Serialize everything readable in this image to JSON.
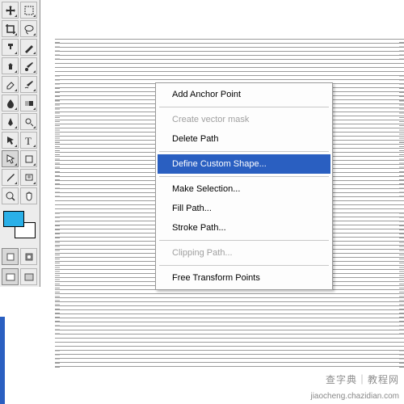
{
  "toolbox": {
    "swatch_fg": "#2ab0e8",
    "swatch_bg": "#ffffff"
  },
  "context_menu": {
    "items": [
      {
        "label": "Add Anchor Point",
        "disabled": false
      },
      {
        "sep": true
      },
      {
        "label": "Create vector mask",
        "disabled": true
      },
      {
        "label": "Delete Path",
        "disabled": false
      },
      {
        "sep": true
      },
      {
        "label": "Define Custom Shape...",
        "disabled": false,
        "highlight": true
      },
      {
        "sep": true
      },
      {
        "label": "Make Selection...",
        "disabled": false
      },
      {
        "label": "Fill Path...",
        "disabled": false
      },
      {
        "label": "Stroke Path...",
        "disabled": false
      },
      {
        "sep": true
      },
      {
        "label": "Clipping Path...",
        "disabled": true
      },
      {
        "sep": true
      },
      {
        "label": "Free Transform Points",
        "disabled": false
      }
    ]
  },
  "watermark": "查字典｜教程网",
  "footer": "jiaocheng.chazidian.com"
}
